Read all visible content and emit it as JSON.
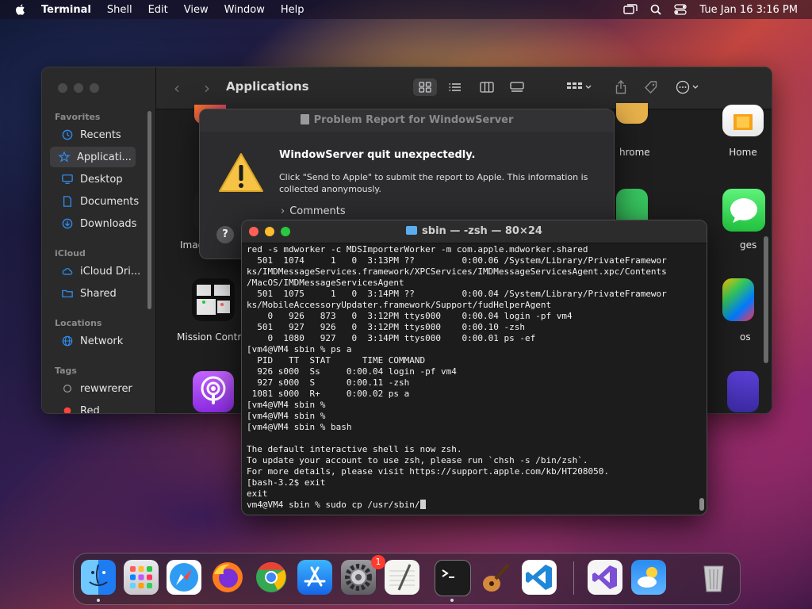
{
  "menubar": {
    "app_name": "Terminal",
    "items": [
      "Shell",
      "Edit",
      "View",
      "Window",
      "Help"
    ],
    "clock": "Tue Jan 16  3:16 PM"
  },
  "finder": {
    "title": "Applications",
    "sidebar": {
      "favorites_header": "Favorites",
      "favorites": [
        "Recents",
        "Applicati...",
        "Desktop",
        "Documents",
        "Downloads"
      ],
      "icloud_header": "iCloud",
      "icloud": [
        "iCloud Dri...",
        "Shared"
      ],
      "locations_header": "Locations",
      "locations": [
        "Network"
      ],
      "tags_header": "Tags",
      "tags": [
        "rewwrerer",
        "Red"
      ]
    },
    "apps": {
      "mission_control": "Mission Contro",
      "image_partial": "Imag",
      "chrome_partial": "hrome",
      "home": "Home",
      "messages_partial": "ges",
      "photos_partial": "os",
      "top_left_partial": "I"
    }
  },
  "report": {
    "title": "Problem Report for WindowServer",
    "heading": "WindowServer quit unexpectedly.",
    "message": "Click \"Send to Apple\" to submit the report to Apple. This information is collected anonymously.",
    "comments": "Comments",
    "help": "?"
  },
  "terminal": {
    "title": "sbin — -zsh — 80×24",
    "lines": [
      "red -s mdworker -c MDSImporterWorker -m com.apple.mdworker.shared",
      "  501  1074     1   0  3:13PM ??         0:00.06 /System/Library/PrivateFramewor",
      "ks/IMDMessageServices.framework/XPCServices/IMDMessageServicesAgent.xpc/Contents",
      "/MacOS/IMDMessageServicesAgent",
      "  501  1075     1   0  3:14PM ??         0:00.04 /System/Library/PrivateFramewor",
      "ks/MobileAccessoryUpdater.framework/Support/fudHelperAgent",
      "    0   926   873   0  3:12PM ttys000    0:00.04 login -pf vm4",
      "  501   927   926   0  3:12PM ttys000    0:00.10 -zsh",
      "    0  1080   927   0  3:14PM ttys000    0:00.01 ps -ef",
      "[vm4@VM4 sbin % ps a",
      "  PID   TT  STAT      TIME COMMAND",
      "  926 s000  Ss     0:00.04 login -pf vm4",
      "  927 s000  S      0:00.11 -zsh",
      " 1081 s000  R+     0:00.02 ps a",
      "[vm4@VM4 sbin %",
      "[vm4@VM4 sbin %",
      "[vm4@VM4 sbin % bash",
      "",
      "The default interactive shell is now zsh.",
      "To update your account to use zsh, please run `chsh -s /bin/zsh`.",
      "For more details, please visit https://support.apple.com/kb/HT208050.",
      "[bash-3.2$ exit",
      "exit"
    ],
    "prompt": "vm4@VM4 sbin % sudo cp /usr/sbin/"
  },
  "dock": {
    "apps": [
      "Finder",
      "Launchpad",
      "Safari",
      "Firefox",
      "Chrome",
      "App Store",
      "System Settings",
      "TextEdit",
      "Terminal",
      "GarageBand",
      "Visual Studio Code",
      "Visual Studio",
      "Weather",
      "Trash"
    ],
    "settings_badge": "1"
  }
}
